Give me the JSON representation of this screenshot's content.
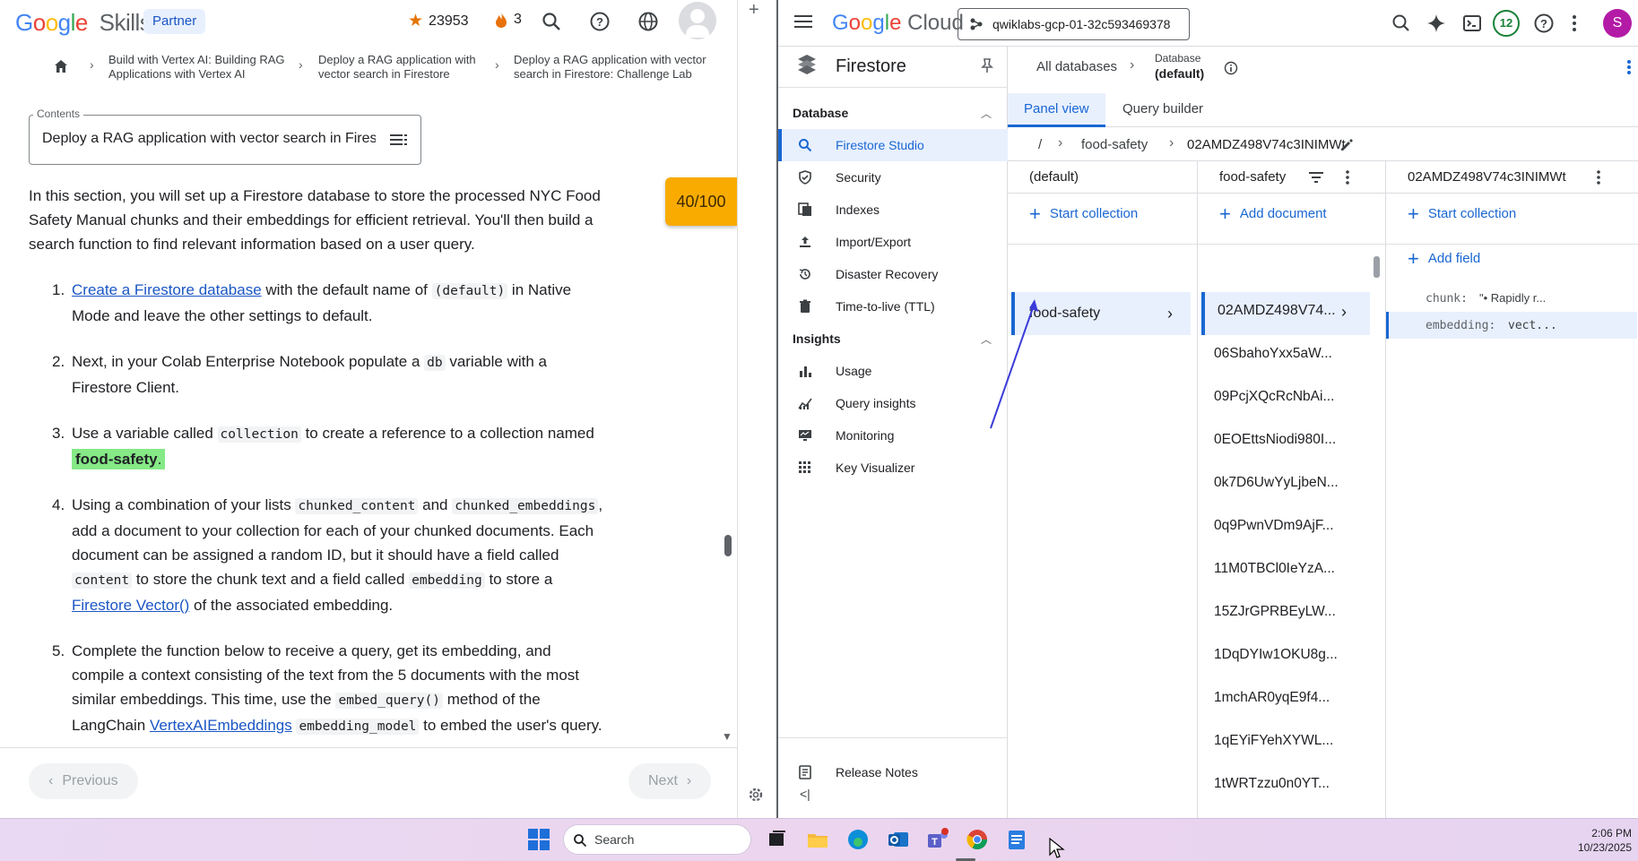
{
  "left": {
    "logo": {
      "google": "Google",
      "skills": "Skills"
    },
    "partner_label": "Partner",
    "points": "23953",
    "streak": "3",
    "breadcrumb": {
      "item1_line1": "Build with Vertex AI: Building RAG",
      "item1_line2": "Applications with Vertex AI",
      "item2_line1": "Deploy a RAG application with",
      "item2_line2": "vector search in Firestore",
      "item3_line1": "Deploy a RAG application with vector",
      "item3_line2": "search in Firestore: Challenge Lab"
    },
    "contents": {
      "label": "Contents",
      "value": "Deploy a RAG application with vector search in Firestore: Challenge Lab"
    },
    "score": "40/100",
    "article": {
      "intro": "In this section, you will set up a Firestore database to store the processed NYC Food Safety Manual chunks and their embeddings for efficient retrieval. You'll then build a search function to find relevant information based on a user query.",
      "step1": {
        "num": "1.",
        "link": "Create a Firestore database",
        "t1": " with the default name of ",
        "code1": "(default)",
        "t2": " in Native Mode and leave the other settings to default."
      },
      "step2": {
        "num": "2.",
        "t1": "Next, in your Colab Enterprise Notebook populate a ",
        "code1": "db",
        "t2": " variable with a Firestore Client."
      },
      "step3": {
        "num": "3.",
        "t1": "Use a variable called ",
        "code1": "collection",
        "t2": " to create a reference to a collection named ",
        "highlight": "food-safety",
        "t3": "."
      },
      "step4": {
        "num": "4.",
        "t1": "Using a combination of your lists ",
        "code1": "chunked_content",
        "t2": " and ",
        "code2": "chunked_embeddings",
        "t3": ", add a document to your collection for each of your chunked documents. Each document can be assigned a random ID, but it should have a field called ",
        "code3": "content",
        "t4": " to store the chunk text and a field called ",
        "code4": "embedding",
        "t5": " to store a ",
        "link": "Firestore Vector()",
        "t6": " of the associated embedding."
      },
      "step5": {
        "num": "5.",
        "t1": "Complete the function below to receive a query, get its embedding, and compile a context consisting of the text from the 5 documents with the most similar embeddings. This time, use the ",
        "code1": "embed_query()",
        "t2": " method of the LangChain ",
        "link": "VertexAIEmbeddings",
        "t3": " ",
        "code2": "embedding_model",
        "t4": " to embed the user's query."
      }
    },
    "prev_label": "Previous",
    "next_label": "Next"
  },
  "cloud": {
    "logo": {
      "google": "Google",
      "cloud": "Cloud"
    },
    "project": "qwiklabs-gcp-01-32c593469378",
    "notifications": "12",
    "avatar_letter": "S",
    "product": "Firestore",
    "database_section": "Database",
    "database_items": [
      "Firestore Studio",
      "Security",
      "Indexes",
      "Import/Export",
      "Disaster Recovery",
      "Time-to-live (TTL)"
    ],
    "insights_section": "Insights",
    "insights_items": [
      "Usage",
      "Query insights",
      "Monitoring",
      "Key Visualizer"
    ],
    "release_notes": "Release Notes",
    "all_databases": "All databases",
    "database_label": "Database",
    "database_name": "(default)",
    "tabs": [
      "Panel view",
      "Query builder"
    ],
    "path": {
      "root": "/",
      "collection": "food-safety",
      "document": "02AMDZ498V74c3INIMWt"
    },
    "col1": {
      "header": "(default)",
      "action": "Start collection",
      "item": "food-safety"
    },
    "col2": {
      "header": "food-safety",
      "action": "Add document",
      "docs": [
        "02AMDZ498V74...",
        "06SbahoYxx5aW...",
        "09PcjXQcRcNbAi...",
        "0EOEttsNiodi980I...",
        "0k7D6UwYyLjbeN...",
        "0q9PwnVDm9AjF...",
        "11M0TBCl0IeYzA...",
        "15ZJrGPRBEyLW...",
        "1DqDYIw1OKU8g...",
        "1mchAR0yqE9f4...",
        "1qEYiFYehXYWL...",
        "1tWRTzzu0n0YT..."
      ]
    },
    "col3": {
      "header": "02AMDZ498V74c3INIMWt",
      "action1": "Start collection",
      "action2": "Add field",
      "field1_key": "chunk:",
      "field1_val": "\"• Rapidly r...",
      "field2_key": "embedding:",
      "field2_val": "vect..."
    }
  },
  "taskbar": {
    "search": "Search",
    "time": "2:06 PM",
    "date": "10/23/2025"
  },
  "colors": {
    "accent": "#1967d2",
    "score_badge": "#f9ab00",
    "highlight": "#85e986",
    "avatar": "#b31aa6"
  }
}
